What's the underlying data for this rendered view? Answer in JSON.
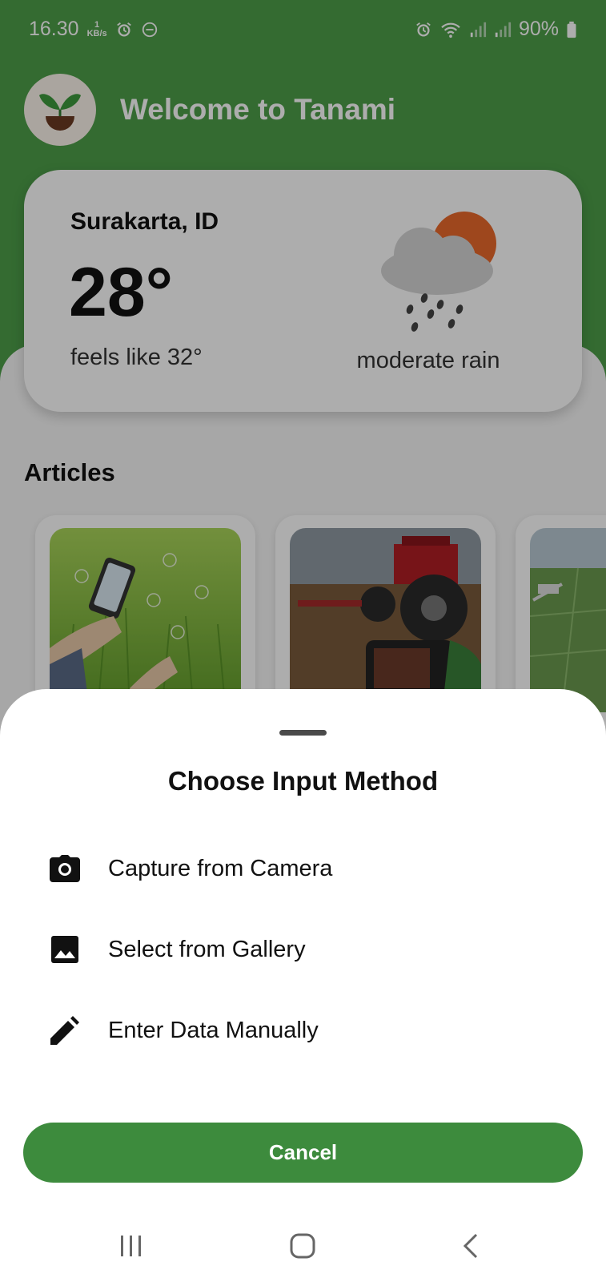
{
  "status_bar": {
    "time": "16.30",
    "net_speed_value": "1",
    "net_speed_unit": "KB/s",
    "battery": "90%"
  },
  "header": {
    "welcome_text": "Welcome to Tanami"
  },
  "weather": {
    "location": "Surakarta, ID",
    "temperature": "28°",
    "feels_like": "feels like 32°",
    "condition": "moderate rain"
  },
  "articles": {
    "title": "Articles"
  },
  "sheet": {
    "title": "Choose Input Method",
    "options": [
      {
        "label": "Capture from Camera",
        "icon": "camera-icon"
      },
      {
        "label": "Select from Gallery",
        "icon": "image-icon"
      },
      {
        "label": "Enter Data Manually",
        "icon": "pencil-icon"
      }
    ],
    "cancel_label": "Cancel"
  },
  "colors": {
    "brand_green": "#4d9e49",
    "button_green": "#3d8b3d"
  }
}
